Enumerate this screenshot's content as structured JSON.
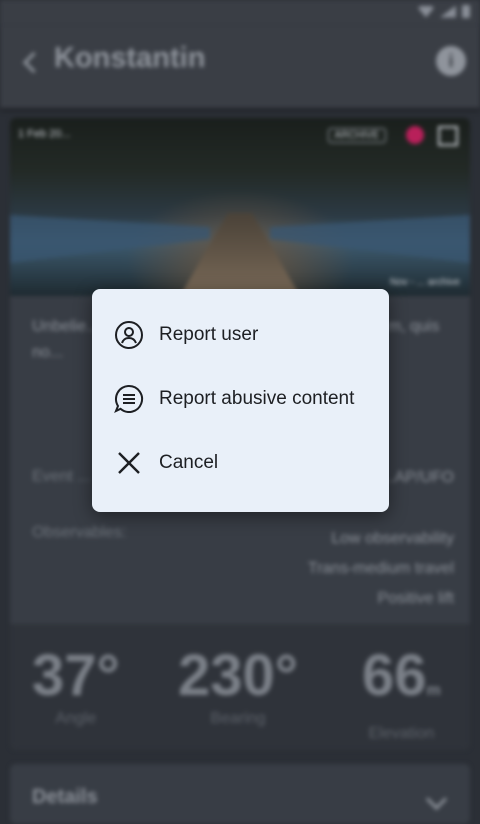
{
  "app": {
    "title": "Konstantin",
    "info_glyph": "i"
  },
  "photo": {
    "date": "1 Feb 20...",
    "badge": "ARCHIVE",
    "credit": "Nov - ... archive"
  },
  "description": "Unbelie... have seen a... lights, sed do... dolore ... m, quis no...",
  "event_row": {
    "label": "Event ...",
    "value": "...AP/UFO"
  },
  "observables": {
    "label": "Observables:",
    "values": [
      "Low observability",
      "Trans-medium travel",
      "Positive lift"
    ]
  },
  "stats": [
    {
      "value": "37°",
      "unit": "",
      "label": "Angle"
    },
    {
      "value": "230°",
      "unit": "",
      "label": "Bearing"
    },
    {
      "value": "66",
      "unit": "m",
      "label": "Elevation"
    }
  ],
  "details": {
    "title": "Details"
  },
  "menu": {
    "items": [
      {
        "label": "Report user",
        "icon": "person-circle-icon"
      },
      {
        "label": "Report abusive content",
        "icon": "chat-bubble-lines-icon"
      },
      {
        "label": "Cancel",
        "icon": "close-icon"
      }
    ]
  },
  "colors": {
    "dialog_bg": "#e9f0f9",
    "background": "#2b2f36",
    "accent_record": "#b8205a"
  }
}
